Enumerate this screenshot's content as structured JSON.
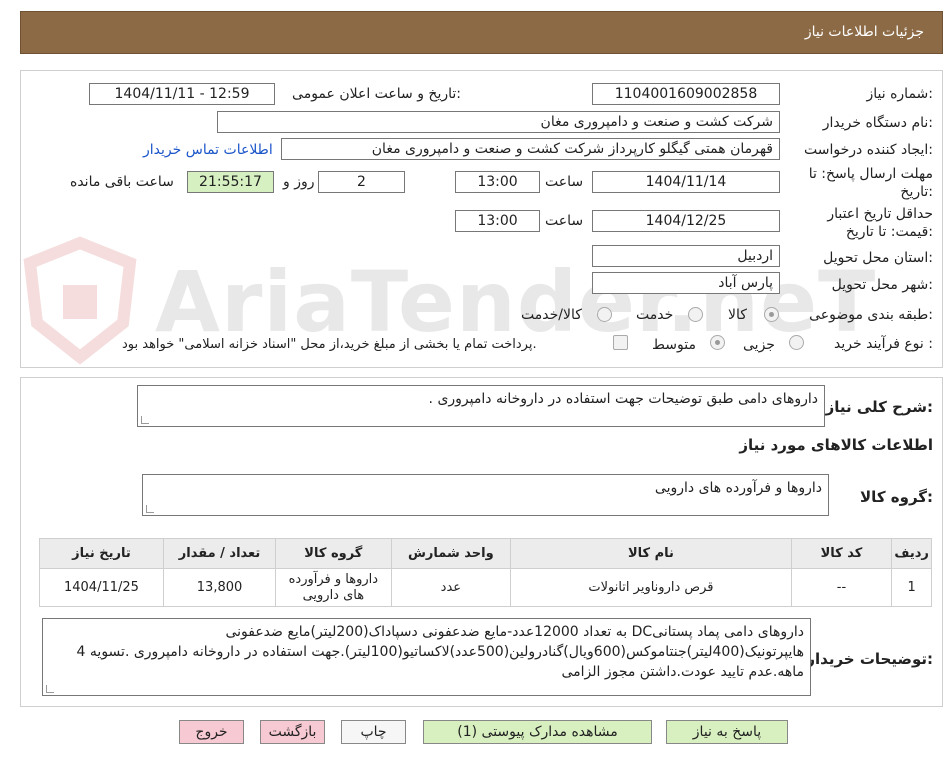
{
  "header": {
    "title": "جزئیات اطلاعات نیاز"
  },
  "watermark": {
    "text": "AriaTender.neT"
  },
  "form": {
    "need_number_label": "شماره نیاز:",
    "need_number": "1104001609002858",
    "announce_label": "تاریخ و ساعت اعلان عمومی:",
    "announce_value": "1404/11/11 - 12:59",
    "buyer_org_label": "نام دستگاه خریدار:",
    "buyer_org": "شرکت کشت و صنعت و دامپروری مغان",
    "requester_label": "ایجاد کننده درخواست:",
    "requester": "قهرمان همتی گیگلو کارپرداز شرکت کشت و صنعت و دامپروری مغان",
    "contact_link": "اطلاعات تماس خریدار",
    "reply_deadline_label_1": "مهلت ارسال پاسخ: تا",
    "reply_deadline_label_2": "تاریخ:",
    "reply_date": "1404/11/14",
    "time_label": "ساعت",
    "reply_time": "13:00",
    "days_value": "2",
    "days_label": "روز و",
    "remaining_time": "21:55:17",
    "remaining_label": "ساعت باقی مانده",
    "validity_label_1": "حداقل تاریخ اعتبار",
    "validity_label_2": "قیمت: تا تاریخ:",
    "validity_date": "1404/12/25",
    "validity_time": "13:00",
    "province_label": "استان محل تحویل:",
    "province": "اردبیل",
    "city_label": "شهر محل تحویل:",
    "city": "پارس آباد",
    "category_label": "طبقه بندی موضوعی:",
    "category_options": [
      "کالا",
      "خدمت",
      "کالا/خدمت"
    ],
    "category_selected": "کالا",
    "process_label": "نوع فرآیند خرید :",
    "process_options": [
      "جزیی",
      "متوسط"
    ],
    "process_selected": "متوسط",
    "payment_note": "پرداخت تمام یا بخشی از مبلغ خرید،از محل \"اسناد خزانه اسلامی\" خواهد بود."
  },
  "summary": {
    "general_desc_label": "شرح کلی نیاز:",
    "general_desc": "داروهای دامی طبق توضیحات جهت استفاده در داروخانه دامپروری .",
    "items_title": "اطلاعات کالاهای مورد نیاز",
    "goods_group_label": "گروه کالا:",
    "goods_group": "داروها و فرآورده های دارویی"
  },
  "table": {
    "headers": [
      "ردیف",
      "کد کالا",
      "نام کالا",
      "واحد شمارش",
      "گروه کالا",
      "تعداد / مقدار",
      "تاریخ نیاز"
    ],
    "rows": [
      {
        "row": "1",
        "code": "--",
        "name": "قرص داروناویر اتانولات",
        "unit": "عدد",
        "group": "داروها و فرآورده های دارویی",
        "qty": "13,800",
        "date": "1404/11/25"
      }
    ]
  },
  "buyer_notes": {
    "label": "توضیحات خریدار:",
    "text": "داروهای دامی پماد پستانیDC به تعداد 12000عدد-مایع ضدعفونی دسپاداک(200لیتر)مایع ضدعفونی هایپرتونیک(400لیتر)جنتاموکس(600ویال)گنادرولین(500عدد)لاکساتیو(100لیتر).جهت استفاده در داروخانه دامپروری .تسویه 4 ماهه.عدم تایید عودت.داشتن مجوز الزامی"
  },
  "buttons": {
    "reply": "پاسخ به نیاز",
    "attachments": "مشاهده مدارک پیوستی (1)",
    "print": "چاپ",
    "back": "بازگشت",
    "exit": "خروج"
  }
}
